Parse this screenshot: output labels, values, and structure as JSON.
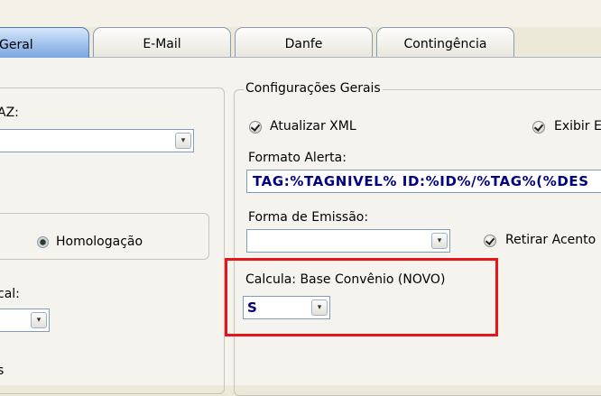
{
  "tabs": [
    {
      "label": "Geral"
    },
    {
      "label": "E-Mail"
    },
    {
      "label": "Danfe"
    },
    {
      "label": "Contingência"
    }
  ],
  "left": {
    "field1_label": "AZ:",
    "field1_value": "",
    "radio_label": "Homologação",
    "field2_label": "cal:",
    "field2_value": "",
    "bottom_label": "s"
  },
  "config": {
    "legend": "Configurações Gerais",
    "atualizar_xml": "Atualizar XML",
    "exibir": "Exibir E",
    "formato_alerta_label": "Formato Alerta:",
    "formato_alerta_value": "TAG:%TAGNIVEL% ID:%ID%/%TAG%(%DES",
    "forma_emissao_label": "Forma de Emissão:",
    "forma_emissao_value": "",
    "retirar_acentos": "Retirar Acento",
    "calcula_label": "Calcula: Base Convênio (NOVO)",
    "calcula_value": "S"
  },
  "icons": {
    "dropdown": "chevron-down-icon",
    "check": "check-icon",
    "radio": "radio-icon"
  },
  "colors": {
    "highlight": "#e8141b",
    "value_text": "#000080",
    "active_tab": "#7aa6de"
  }
}
